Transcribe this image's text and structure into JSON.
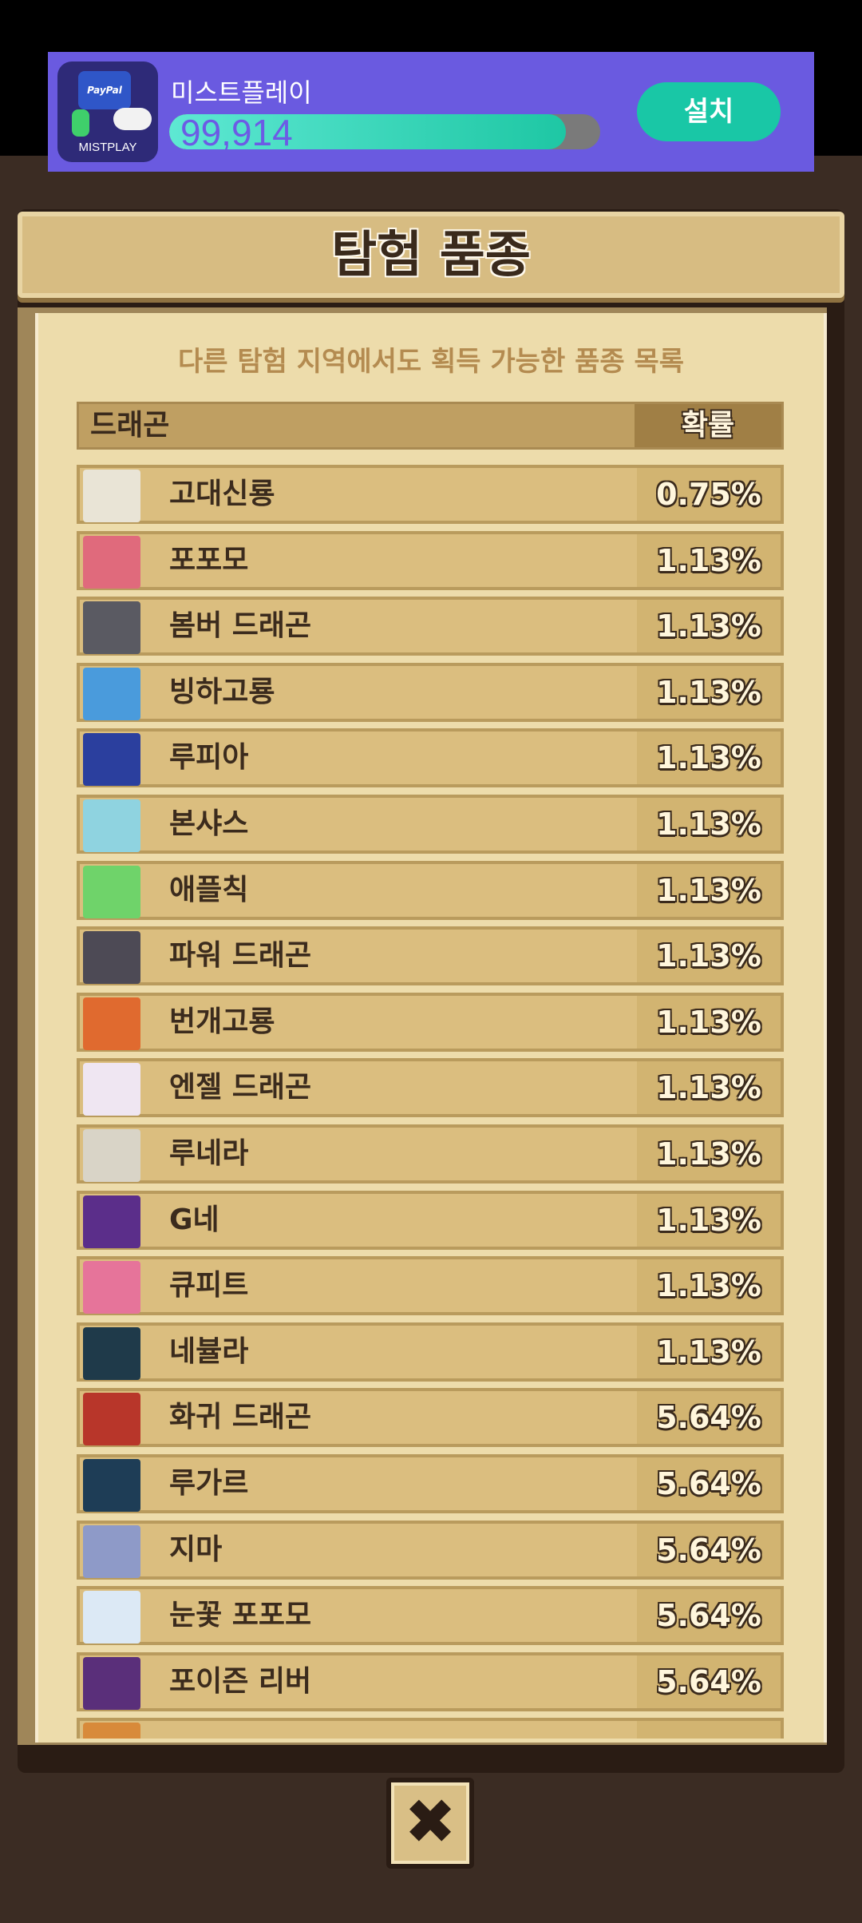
{
  "ad": {
    "app_name": "미스트플레이",
    "icon_badge": "PayPal",
    "icon_brand": "MISTPLAY",
    "progress_value": "99,914",
    "progress_fraction": 0.92,
    "install_label": "설치"
  },
  "dialog": {
    "title": "탐험 품종",
    "subtitle": "다른 탐험 지역에서도 획득 가능한 품종 목록",
    "columns": {
      "dragon": "드래곤",
      "probability": "확률"
    },
    "rows": [
      {
        "name": "고대신룡",
        "prob": "0.75%",
        "icon": "ancient-dragon-icon",
        "color": "#e9e4d6"
      },
      {
        "name": "포포모",
        "prob": "1.13%",
        "icon": "popomo-icon",
        "color": "#e06a7c"
      },
      {
        "name": "봄버 드래곤",
        "prob": "1.13%",
        "icon": "bomber-dragon-icon",
        "color": "#5a5a62"
      },
      {
        "name": "빙하고룡",
        "prob": "1.13%",
        "icon": "glacier-dragon-icon",
        "color": "#4a9bdc"
      },
      {
        "name": "루피아",
        "prob": "1.13%",
        "icon": "lupia-icon",
        "color": "#2b3f9e"
      },
      {
        "name": "본샤스",
        "prob": "1.13%",
        "icon": "bonshas-icon",
        "color": "#8fd3e0"
      },
      {
        "name": "애플칙",
        "prob": "1.13%",
        "icon": "applechick-icon",
        "color": "#6fd36a"
      },
      {
        "name": "파워 드래곤",
        "prob": "1.13%",
        "icon": "power-dragon-icon",
        "color": "#4d4a55"
      },
      {
        "name": "번개고룡",
        "prob": "1.13%",
        "icon": "thunder-dragon-icon",
        "color": "#e06a2f"
      },
      {
        "name": "엔젤 드래곤",
        "prob": "1.13%",
        "icon": "angel-dragon-icon",
        "color": "#efe6f2"
      },
      {
        "name": "루네라",
        "prob": "1.13%",
        "icon": "lunera-icon",
        "color": "#d9d4c7"
      },
      {
        "name": "G네",
        "prob": "1.13%",
        "icon": "gne-icon",
        "color": "#5b2e8a"
      },
      {
        "name": "큐피트",
        "prob": "1.13%",
        "icon": "cupid-icon",
        "color": "#e6749a"
      },
      {
        "name": "네뷸라",
        "prob": "1.13%",
        "icon": "nebula-icon",
        "color": "#1f3a4a"
      },
      {
        "name": "화귀 드래곤",
        "prob": "5.64%",
        "icon": "fire-demon-dragon-icon",
        "color": "#b8362a"
      },
      {
        "name": "루가르",
        "prob": "5.64%",
        "icon": "lugar-icon",
        "color": "#1e3d56"
      },
      {
        "name": "지마",
        "prob": "5.64%",
        "icon": "jima-icon",
        "color": "#8e9ac8"
      },
      {
        "name": "눈꽃 포포모",
        "prob": "5.64%",
        "icon": "snowflake-popomo-icon",
        "color": "#dce9f5"
      },
      {
        "name": "포이즌 리버",
        "prob": "5.64%",
        "icon": "poison-river-icon",
        "color": "#5a2f7a"
      },
      {
        "name": "",
        "prob": "",
        "icon": "partial-dragon-icon",
        "color": "#d88a3a"
      }
    ]
  },
  "close": {
    "label": "✖"
  }
}
